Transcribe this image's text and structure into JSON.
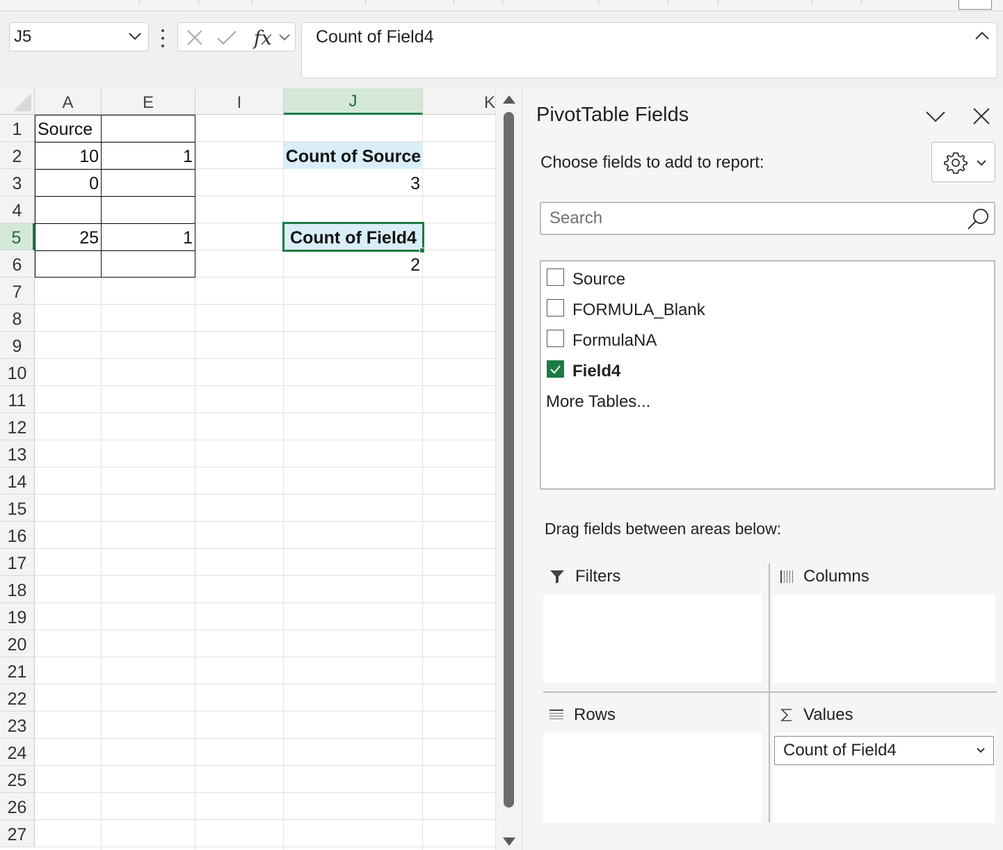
{
  "formula_bar": {
    "name_box": "J5",
    "formula": "Count of Field4",
    "fx_label": "fx"
  },
  "sheet": {
    "columns": [
      "A",
      "E",
      "I",
      "J",
      "K"
    ],
    "active_column": "J",
    "rows": [
      "1",
      "2",
      "3",
      "4",
      "5",
      "6",
      "7",
      "8",
      "9",
      "10",
      "11",
      "12",
      "13",
      "14",
      "15",
      "16",
      "17",
      "18",
      "19",
      "20",
      "21",
      "22",
      "23",
      "24",
      "25",
      "26",
      "27"
    ],
    "active_row": "5",
    "cells": {
      "A1": "Source",
      "A2": "10",
      "E2": "1",
      "A3": "0",
      "A5": "25",
      "E5": "1",
      "J2": "Count of Source",
      "J3": "3",
      "J5": "Count of Field4",
      "J6": "2"
    }
  },
  "pivot_pane": {
    "title": "PivotTable Fields",
    "choose_label": "Choose fields to add to report:",
    "search_placeholder": "Search",
    "fields": [
      {
        "label": "Source",
        "checked": false
      },
      {
        "label": "FORMULA_Blank",
        "checked": false
      },
      {
        "label": "FormulaNA",
        "checked": false
      },
      {
        "label": "Field4",
        "checked": true
      }
    ],
    "more_tables": "More Tables...",
    "drag_label": "Drag fields between areas below:",
    "areas": {
      "filters": "Filters",
      "columns": "Columns",
      "rows": "Rows",
      "values": "Values"
    },
    "value_items": [
      "Count of Field4"
    ]
  },
  "colors": {
    "accent_green": "#1d7a43",
    "pivot_header_fill": "#d9eef8"
  }
}
